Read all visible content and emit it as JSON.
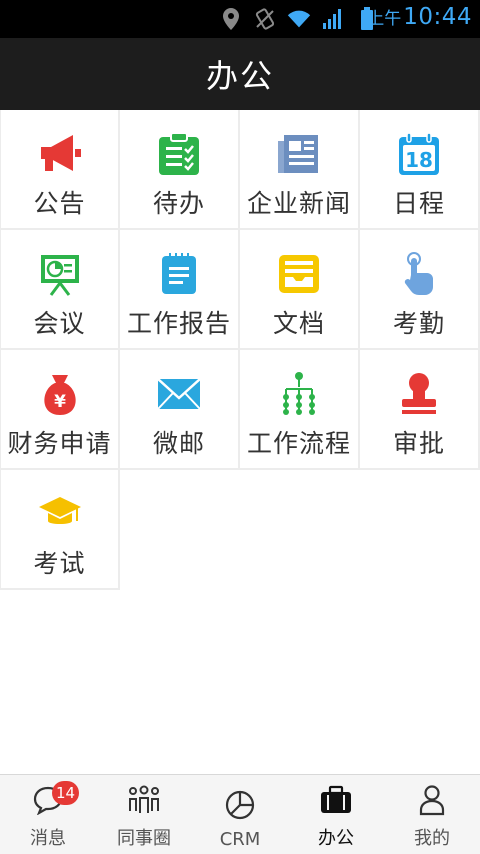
{
  "status_bar": {
    "ampm": "上午",
    "time": "10:44",
    "icons": [
      "location-icon",
      "vibrate-icon",
      "wifi-icon",
      "signal-icon",
      "battery-icon"
    ]
  },
  "header": {
    "title": "办公"
  },
  "apps": [
    {
      "label": "公告",
      "icon": "megaphone-icon",
      "color": "#e53935"
    },
    {
      "label": "待办",
      "icon": "clipboard-check-icon",
      "color": "#2db34a"
    },
    {
      "label": "企业新闻",
      "icon": "newspaper-icon",
      "color": "#6c8ebf"
    },
    {
      "label": "日程",
      "icon": "calendar-icon",
      "color": "#1ea1e6"
    },
    {
      "label": "会议",
      "icon": "presentation-icon",
      "color": "#2db34a"
    },
    {
      "label": "工作报告",
      "icon": "report-icon",
      "color": "#2aa7de"
    },
    {
      "label": "文档",
      "icon": "document-tray-icon",
      "color": "#f6c800"
    },
    {
      "label": "考勤",
      "icon": "hand-tap-icon",
      "color": "#6ea4de"
    },
    {
      "label": "财务申请",
      "icon": "money-bag-icon",
      "color": "#e53935"
    },
    {
      "label": "微邮",
      "icon": "envelope-icon",
      "color": "#2aa7de"
    },
    {
      "label": "工作流程",
      "icon": "flow-tree-icon",
      "color": "#2db34a"
    },
    {
      "label": "审批",
      "icon": "stamp-icon",
      "color": "#e53935"
    },
    {
      "label": "考试",
      "icon": "graduation-cap-icon",
      "color": "#f6c000"
    }
  ],
  "tabbar": {
    "items": [
      {
        "label": "消息",
        "icon": "chat-bubble-icon",
        "badge": "14"
      },
      {
        "label": "同事圈",
        "icon": "colleagues-icon"
      },
      {
        "label": "CRM",
        "icon": "pie-chart-icon"
      },
      {
        "label": "办公",
        "icon": "briefcase-icon",
        "active": true
      },
      {
        "label": "我的",
        "icon": "person-icon"
      }
    ]
  }
}
